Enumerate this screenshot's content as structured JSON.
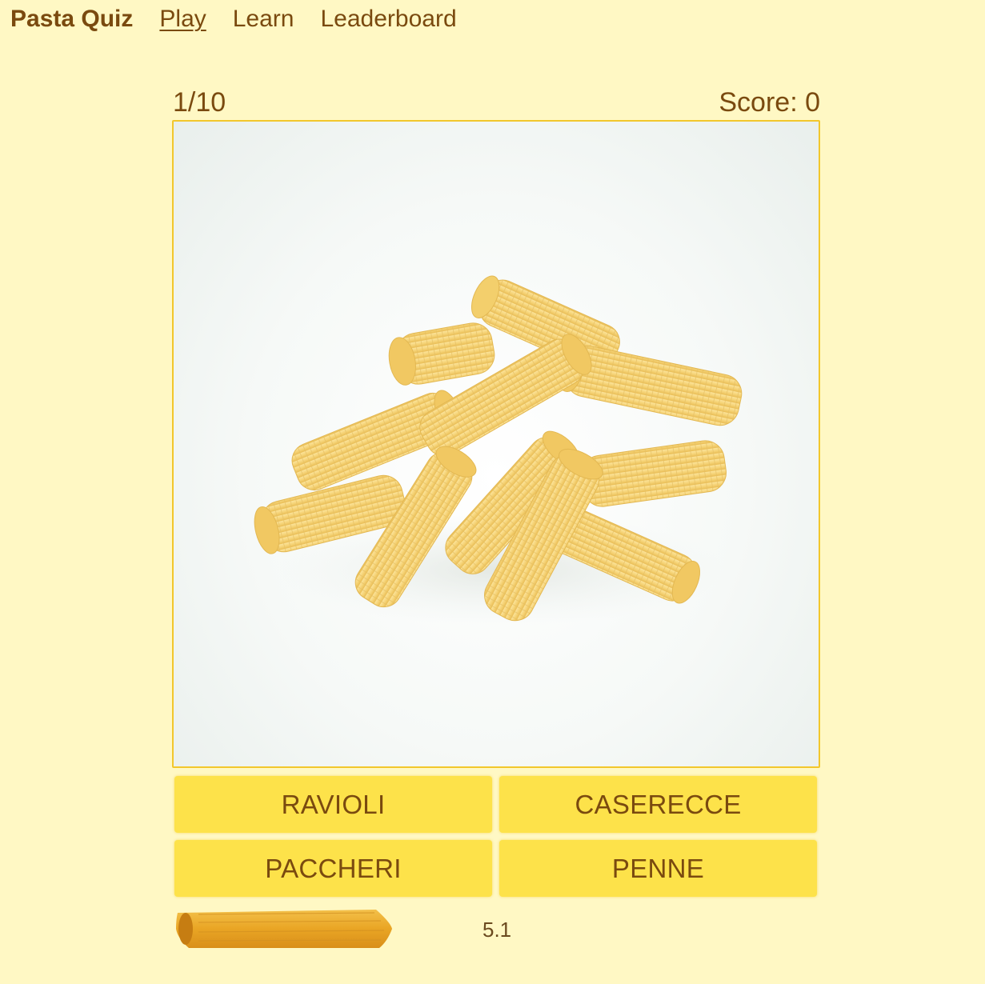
{
  "nav": {
    "brand": "Pasta Quiz",
    "links": [
      {
        "label": "Play",
        "active": true
      },
      {
        "label": "Learn",
        "active": false
      },
      {
        "label": "Leaderboard",
        "active": false
      }
    ]
  },
  "quiz": {
    "progress": "1/10",
    "score": "Score: 0",
    "answers": [
      "RAVIOLI",
      "CASERECCE",
      "PACCHERI",
      "PENNE"
    ],
    "timer": "5.1"
  },
  "colors": {
    "background": "#fff8c4",
    "button": "#fde24a",
    "text": "#7a4a0f",
    "border": "#f2c72c"
  }
}
